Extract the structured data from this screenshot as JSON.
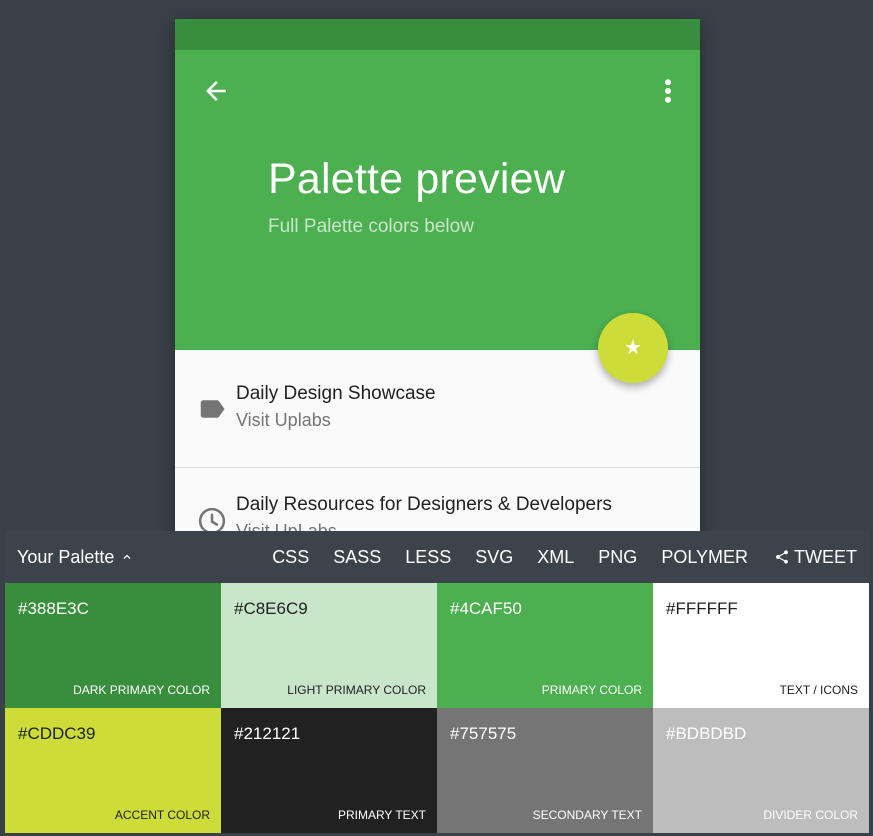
{
  "app": {
    "title": "Palette preview",
    "subtitle": "Full Palette colors below",
    "icons": {
      "back": "arrow-back-icon",
      "more": "more-vert-icon",
      "fab": "star-icon"
    },
    "list": [
      {
        "primary": "Daily Design Showcase",
        "secondary": "Visit Uplabs",
        "icon": "label-icon"
      },
      {
        "primary": "Daily Resources for Designers & Developers",
        "secondary": "Visit UpLabs",
        "icon": "clock-icon"
      }
    ]
  },
  "palette": {
    "title": "Your Palette",
    "exports": [
      "CSS",
      "SASS",
      "LESS",
      "SVG",
      "XML",
      "PNG",
      "POLYMER"
    ],
    "tweet": "TWEET",
    "swatches": [
      {
        "hex": "#388E3C",
        "label": "DARK PRIMARY COLOR",
        "color": "#388e3c",
        "text": "light"
      },
      {
        "hex": "#C8E6C9",
        "label": "LIGHT PRIMARY COLOR",
        "color": "#c8e6c9",
        "text": "dark"
      },
      {
        "hex": "#4CAF50",
        "label": "PRIMARY COLOR",
        "color": "#4caf50",
        "text": "light"
      },
      {
        "hex": "#FFFFFF",
        "label": "TEXT / ICONS",
        "color": "#ffffff",
        "text": "dark"
      },
      {
        "hex": "#CDDC39",
        "label": "ACCENT COLOR",
        "color": "#cddc39",
        "text": "dark"
      },
      {
        "hex": "#212121",
        "label": "PRIMARY TEXT",
        "color": "#212121",
        "text": "light"
      },
      {
        "hex": "#757575",
        "label": "SECONDARY TEXT",
        "color": "#757575",
        "text": "light"
      },
      {
        "hex": "#BDBDBD",
        "label": "DIVIDER COLOR",
        "color": "#bdbdbd",
        "text": "light"
      }
    ]
  },
  "colors": {
    "background": "#3a4048",
    "bar": "#3d434b",
    "dark_primary": "#388e3c",
    "primary": "#4caf50",
    "accent": "#cddc39"
  }
}
